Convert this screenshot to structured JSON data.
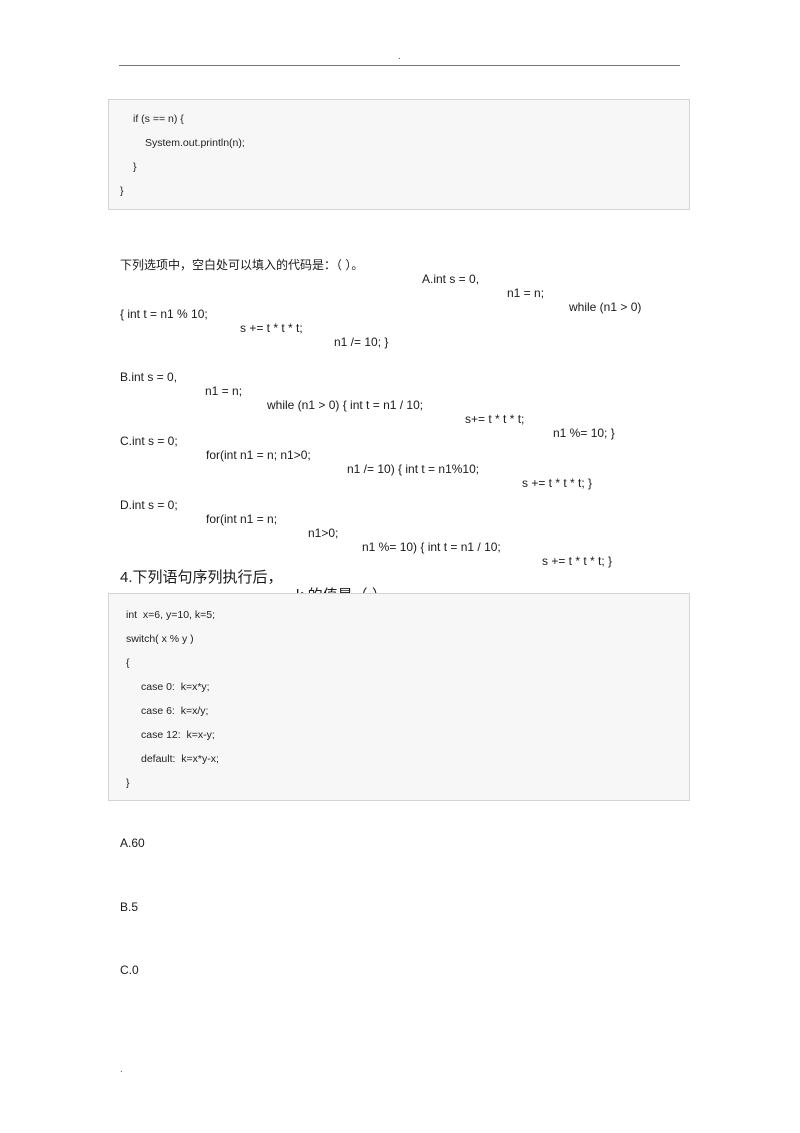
{
  "header": {
    "mark": "."
  },
  "code_block_1": {
    "lines": [
      "if (s == n) {",
      "System.out.println(n);",
      "}",
      "}"
    ]
  },
  "question3": {
    "prompt": "下列选项中，空白处可以填入的代码是：（ ）。",
    "options": {
      "A": {
        "parts": [
          "A.int s = 0,",
          "n1 = n;",
          "while (n1 > 0)"
        ],
        "continuation": [
          "{ int t = n1 % 10;",
          "s += t * t * t;",
          "n1 /= 10; }"
        ]
      },
      "B": {
        "parts": [
          "B.int s = 0,",
          "n1 = n;",
          "while (n1 > 0) { int t = n1 / 10;",
          "s+= t * t * t;",
          "n1 %= 10; }"
        ]
      },
      "C": {
        "parts": [
          "C.int s = 0;",
          "for(int n1 = n; n1>0;",
          "n1 /= 10) { int t = n1%10;",
          "s += t * t * t; }"
        ]
      },
      "D": {
        "parts": [
          "D.int s = 0;",
          "for(int n1 = n;",
          "n1>0;",
          "n1 %= 10) { int t = n1 / 10;",
          "s += t * t * t; }"
        ]
      }
    }
  },
  "question4": {
    "title": "4.下列语句序列执行后，",
    "title_var": "k 的值是（ ）",
    "code_lines": [
      "int  x=6, y=10, k=5;",
      "switch( x % y )",
      "{",
      "case 0:  k=x*y;",
      "case 6:  k=x/y;",
      "case 12:  k=x-y;",
      "default:  k=x*y-x;",
      "}"
    ],
    "answers": [
      "A.60",
      "B.5",
      "C.0"
    ]
  },
  "footer": {
    "mark": "."
  }
}
